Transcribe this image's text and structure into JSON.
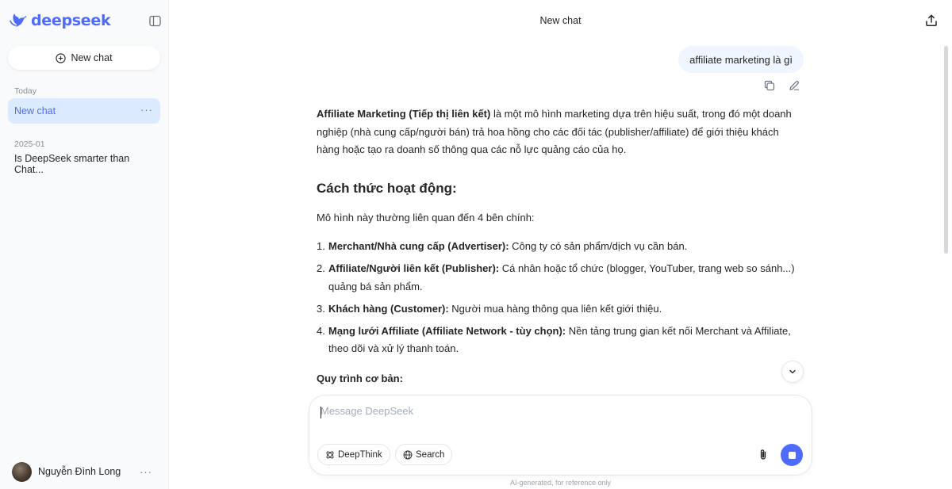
{
  "sidebar": {
    "logo_text": "deepseek",
    "new_chat_label": "New chat",
    "sections": [
      {
        "label": "Today",
        "items": [
          {
            "label": "New chat",
            "active": true
          }
        ]
      },
      {
        "label": "2025-01",
        "items": [
          {
            "label": "Is DeepSeek smarter than Chat..."
          }
        ]
      }
    ],
    "user_name": "Nguyễn Đình Long",
    "more_glyph": "···"
  },
  "header": {
    "title": "New chat",
    "share_icon": "share-icon"
  },
  "conversation": {
    "user_message": "affiliate marketing là gì",
    "answer": {
      "intro_bold": "Affiliate Marketing (Tiếp thị liên kết)",
      "intro_rest": " là một mô hình marketing dựa trên hiệu suất, trong đó một doanh nghiệp (nhà cung cấp/người bán) trả hoa hồng cho các đối tác (publisher/affiliate) để giới thiệu khách hàng hoặc tạo ra doanh số thông qua các nỗ lực quảng cáo của họ.",
      "heading": "Cách thức hoạt động:",
      "parties_intro": "Mô hình này thường liên quan đến 4 bên chính:",
      "parties": [
        {
          "num": "1.",
          "bold": "Merchant/Nhà cung cấp (Advertiser):",
          "text": " Công ty có sản phẩm/dịch vụ cần bán."
        },
        {
          "num": "2.",
          "bold": "Affiliate/Người liên kết (Publisher):",
          "text": " Cá nhân hoặc tổ chức (blogger, YouTuber, trang web so sánh...) quảng bá sản phẩm."
        },
        {
          "num": "3.",
          "bold": "Khách hàng (Customer):",
          "text": " Người mua hàng thông qua liên kết giới thiệu."
        },
        {
          "num": "4.",
          "bold": "Mạng lưới Affiliate (Affiliate Network - tùy chọn):",
          "text": " Nền tảng trung gian kết nối Merchant và Affiliate, theo dõi và xử lý thanh toán."
        }
      ],
      "process_heading": "Quy trình cơ bản:"
    }
  },
  "composer": {
    "placeholder": "Message DeepSeek",
    "deepthink_label": "DeepThink",
    "search_label": "Search"
  },
  "footer": {
    "disclaimer": "AI-generated, for reference only"
  },
  "colors": {
    "accent": "#4d6bfe",
    "active_item_bg": "#dbeafe",
    "user_bubble_bg": "#eff6ff"
  }
}
